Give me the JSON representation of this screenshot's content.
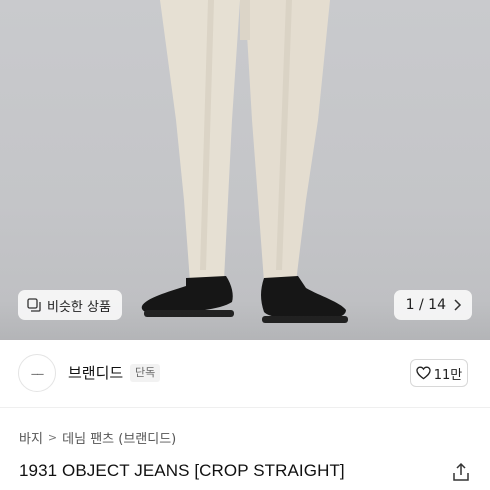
{
  "hero": {
    "similar_label": "비슷한 상품",
    "pager": "1 / 14"
  },
  "brand": {
    "logo_text": "——",
    "name": "브랜디드",
    "badge": "단독",
    "likes": "11만"
  },
  "breadcrumb": [
    "바지",
    "데님 팬츠 (브랜디드)"
  ],
  "product": {
    "title": "1931 OBJECT JEANS [CROP STRAIGHT]"
  },
  "icons": {
    "similar": "similar-products-icon",
    "pager_next": "chevron-right-icon",
    "like": "heart-icon",
    "share": "share-icon"
  }
}
